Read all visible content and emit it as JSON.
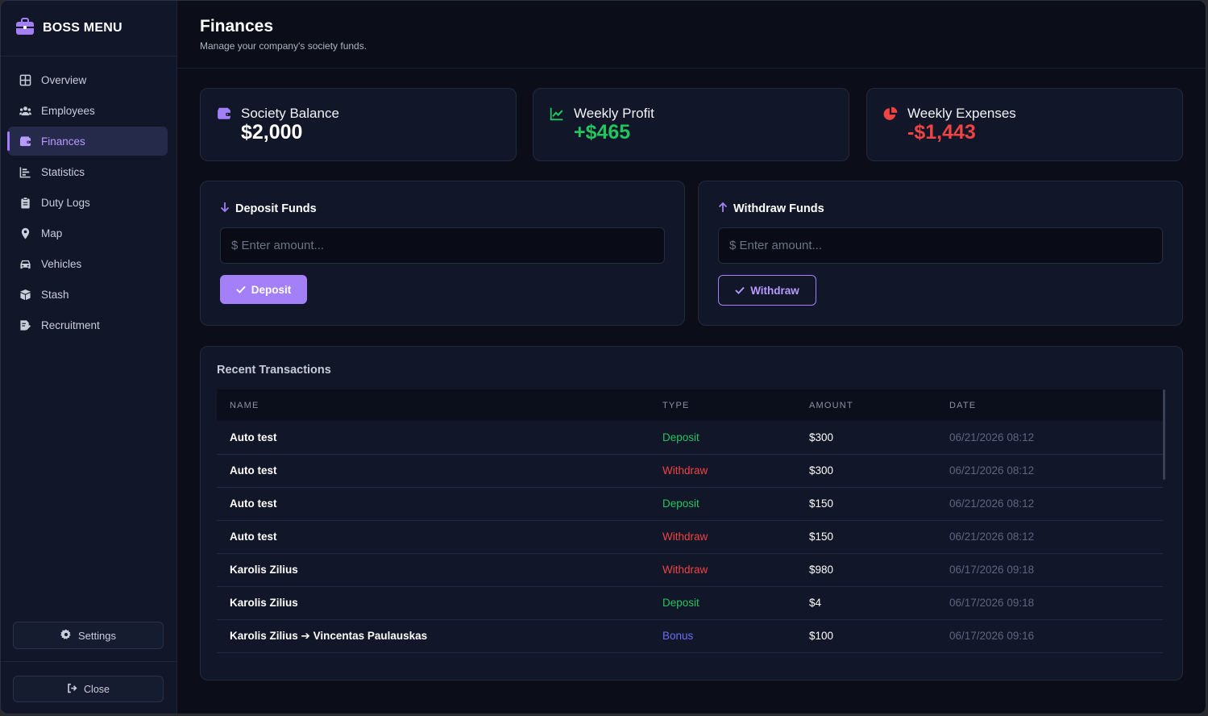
{
  "brand": {
    "title": "BOSS MENU",
    "icon": "briefcase-icon"
  },
  "sidebar": {
    "items": [
      {
        "label": "Overview",
        "icon": "grid-icon",
        "active": false
      },
      {
        "label": "Employees",
        "icon": "users-icon",
        "active": false
      },
      {
        "label": "Finances",
        "icon": "wallet-icon",
        "active": true
      },
      {
        "label": "Statistics",
        "icon": "bar-chart-icon",
        "active": false
      },
      {
        "label": "Duty Logs",
        "icon": "clipboard-icon",
        "active": false
      },
      {
        "label": "Map",
        "icon": "map-pin-icon",
        "active": false
      },
      {
        "label": "Vehicles",
        "icon": "car-icon",
        "active": false
      },
      {
        "label": "Stash",
        "icon": "box-icon",
        "active": false
      },
      {
        "label": "Recruitment",
        "icon": "file-signature-icon",
        "active": false
      }
    ],
    "settings_label": "Settings",
    "close_label": "Close"
  },
  "header": {
    "title": "Finances",
    "subtitle": "Manage your company's society funds."
  },
  "stats": [
    {
      "label": "Society Balance",
      "value": "$2,000",
      "icon": "wallet-icon",
      "color": "#ffffff"
    },
    {
      "label": "Weekly Profit",
      "value": "+$465",
      "icon": "trend-up-icon",
      "color": "#22c55e"
    },
    {
      "label": "Weekly Expenses",
      "value": "-$1,443",
      "icon": "pie-chart-icon",
      "color": "#ef4444"
    }
  ],
  "deposit": {
    "title": "Deposit Funds",
    "placeholder": "$ Enter amount...",
    "button_label": "Deposit"
  },
  "withdraw": {
    "title": "Withdraw Funds",
    "placeholder": "$ Enter amount...",
    "button_label": "Withdraw"
  },
  "transactions": {
    "title": "Recent Transactions",
    "columns": [
      "NAME",
      "TYPE",
      "AMOUNT",
      "DATE"
    ],
    "rows": [
      {
        "name": "Auto test",
        "type": "Deposit",
        "amount": "$300",
        "date": "06/21/2026 08:12"
      },
      {
        "name": "Auto test",
        "type": "Withdraw",
        "amount": "$300",
        "date": "06/21/2026 08:12"
      },
      {
        "name": "Auto test",
        "type": "Deposit",
        "amount": "$150",
        "date": "06/21/2026 08:12"
      },
      {
        "name": "Auto test",
        "type": "Withdraw",
        "amount": "$150",
        "date": "06/21/2026 08:12"
      },
      {
        "name": "Karolis Zilius",
        "type": "Withdraw",
        "amount": "$980",
        "date": "06/17/2026 09:18"
      },
      {
        "name": "Karolis Zilius",
        "type": "Deposit",
        "amount": "$4",
        "date": "06/17/2026 09:18"
      },
      {
        "name": "Karolis Zilius ➔ Vincentas Paulauskas",
        "type": "Bonus",
        "amount": "$100",
        "date": "06/17/2026 09:16"
      }
    ]
  },
  "colors": {
    "accent": "#a380f7",
    "deposit": "#22c55e",
    "withdraw": "#ef4444",
    "bonus": "#6b6ef0"
  }
}
